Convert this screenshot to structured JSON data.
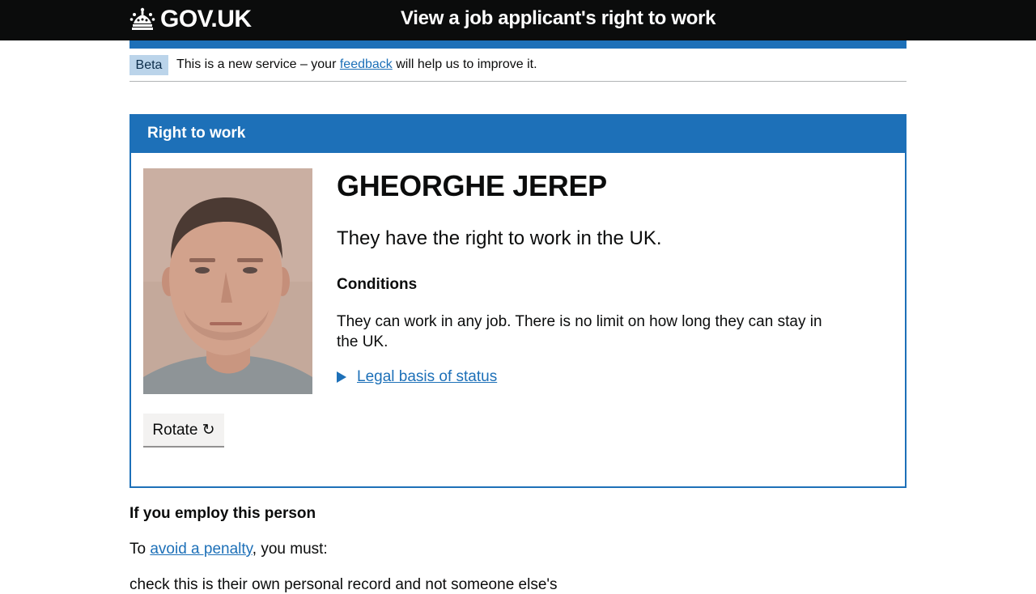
{
  "header": {
    "logo_text": "GOV.UK",
    "logo_icon": "crown-icon",
    "service_name": "View a job applicant's right to work"
  },
  "phase_banner": {
    "tag": "Beta",
    "text_before": "This is a new service – your ",
    "link": "feedback",
    "text_after": " will help us to improve it."
  },
  "panel": {
    "title": "Right to work",
    "person_name": "GHEORGHE JEREP",
    "status": "They have the right to work in the UK.",
    "conditions_heading": "Conditions",
    "conditions_text": "They can work in any job. There is no limit on how long they can stay in the UK.",
    "details_summary": "Legal basis of status",
    "rotate_button": "Rotate ↻"
  },
  "employ": {
    "heading": "If you employ this person",
    "text_before": "To ",
    "link": "avoid a penalty",
    "text_after": ", you must:",
    "list_item_partial": "check this is their own personal record and not someone else's"
  },
  "colors": {
    "header_bg": "#0b0c0c",
    "brand_blue": "#1d70b8",
    "phase_tag_bg": "#bbd4ea",
    "button_bg": "#f3f2f1"
  }
}
